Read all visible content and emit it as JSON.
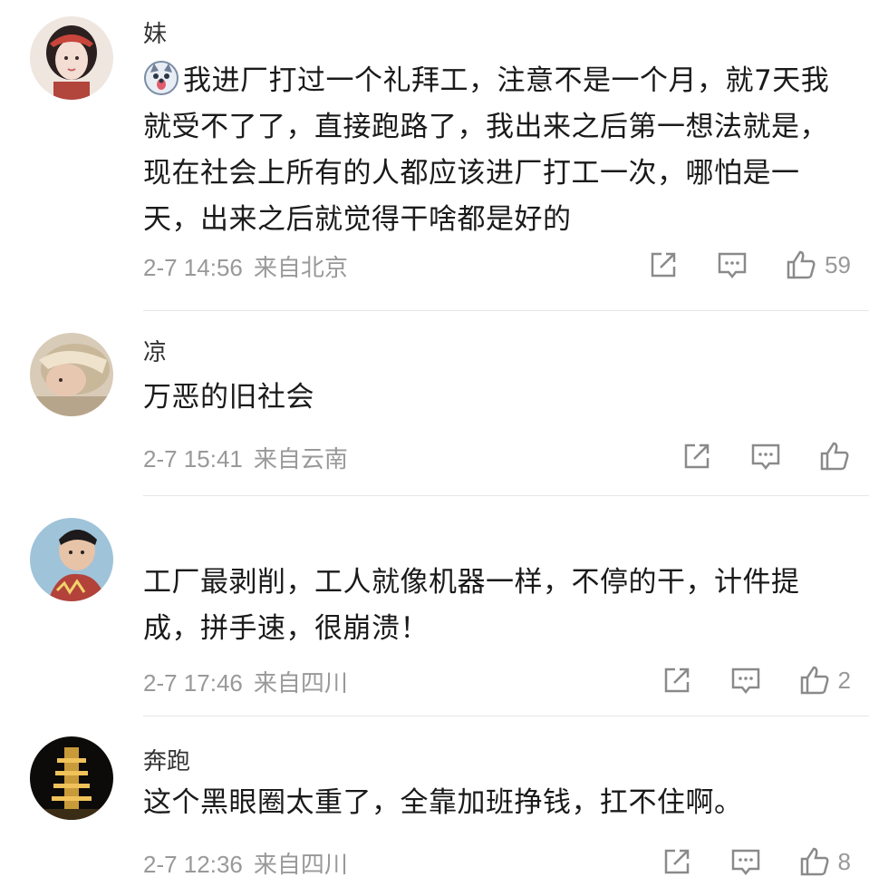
{
  "comments": [
    {
      "username": "妹",
      "text": "我进厂打过一个礼拜工，注意不是一个月，就7天我就受不了了，直接跑路了，我出来之后第一想法就是，现在社会上所有的人都应该进厂打工一次，哪怕是一天，出来之后就觉得干啥都是好的",
      "time": "2-7 14:56",
      "location": "来自北京",
      "likes": "59"
    },
    {
      "username": "凉",
      "text": "万恶的旧社会",
      "time": "2-7 15:41",
      "location": "来自云南",
      "likes": ""
    },
    {
      "username": "",
      "text": "工厂最剥削，工人就像机器一样，不停的干，计件提成，拼手速，很崩溃！",
      "time": "2-7 17:46",
      "location": "来自四川",
      "likes": "2"
    },
    {
      "username": "奔跑",
      "text": "这个黑眼圈太重了，全靠加班挣钱，扛不住啊。",
      "time": "2-7 12:36",
      "location": "来自四川",
      "likes": "8"
    }
  ],
  "icons": {
    "share": "share-icon",
    "comment": "comment-icon",
    "like": "thumbs-up-icon"
  }
}
